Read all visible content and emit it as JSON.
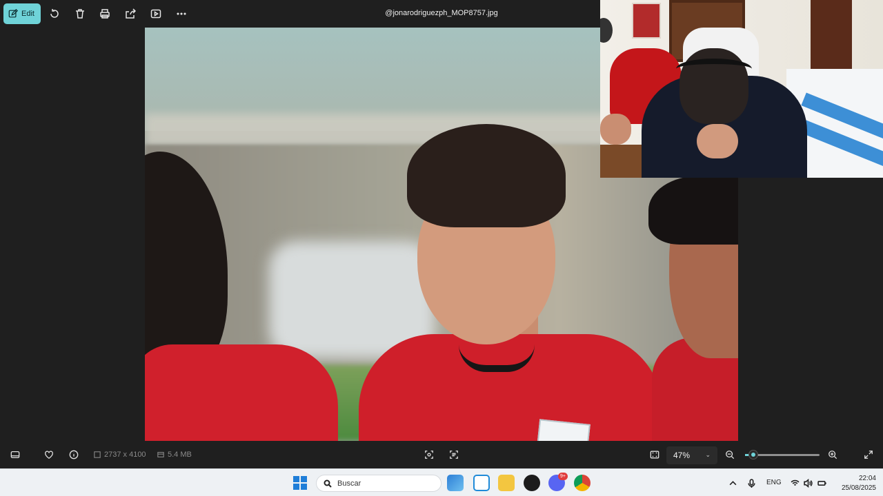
{
  "toolbar": {
    "edit_label": "Edit",
    "icons": [
      "rotate-icon",
      "delete-icon",
      "print-icon",
      "share-icon",
      "slideshow-icon",
      "more-icon"
    ]
  },
  "file": {
    "title": "@jonarodriguezph_MOP8757.jpg",
    "dimensions": "2737 x 4100",
    "size": "5.4 MB"
  },
  "zoom": {
    "value": "47%",
    "level_percent": 47
  },
  "taskbar": {
    "search_placeholder": "Buscar",
    "language": "ENG",
    "time": "22:04",
    "date": "25/08/2025",
    "badge_count": "9+"
  },
  "colors": {
    "accent": "#6fd3d8",
    "background": "#1f1f1f",
    "taskbar": "#eef1f4"
  }
}
